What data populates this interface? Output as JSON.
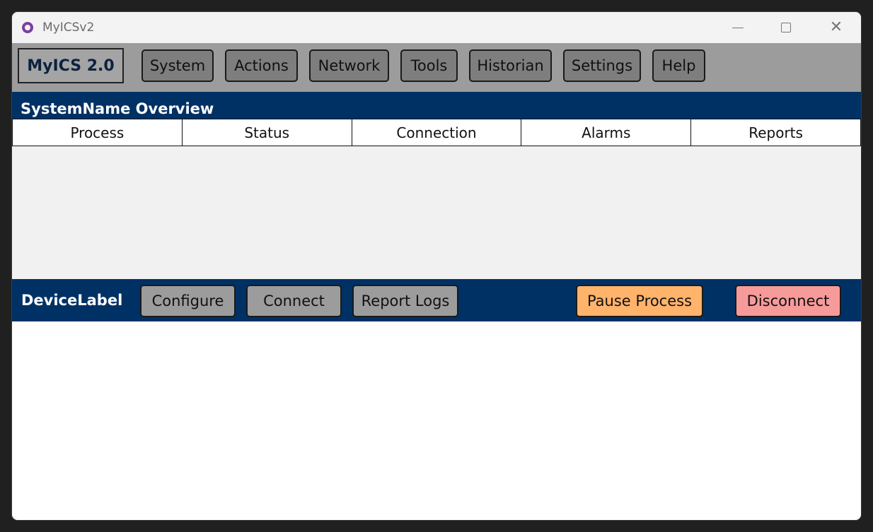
{
  "window": {
    "title": "MyICSv2",
    "icon": "app-logo-icon"
  },
  "window_controls": {
    "minimize_icon": "minimize-icon",
    "maximize_icon": "maximize-icon",
    "close_icon": "close-icon",
    "close_glyph": "✕"
  },
  "menubar": {
    "brand": "MyICS 2.0",
    "items": [
      "System",
      "Actions",
      "Network",
      "Tools",
      "Historian",
      "Settings",
      "Help"
    ]
  },
  "overview": {
    "title": "SystemName Overview",
    "tabs": [
      "Process",
      "Status",
      "Connection",
      "Alarms",
      "Reports"
    ]
  },
  "devicebar": {
    "label": "DeviceLabel",
    "buttons": {
      "configure": "Configure",
      "connect": "Connect",
      "report_logs": "Report Logs",
      "pause_process": "Pause Process",
      "disconnect": "Disconnect"
    }
  },
  "colors": {
    "header_blue": "#003165",
    "menubar_grey": "#9c9c9c",
    "button_grey": "#7e7e7e",
    "pause_orange": "#ffb36b",
    "disconnect_red": "#f79a9a"
  }
}
